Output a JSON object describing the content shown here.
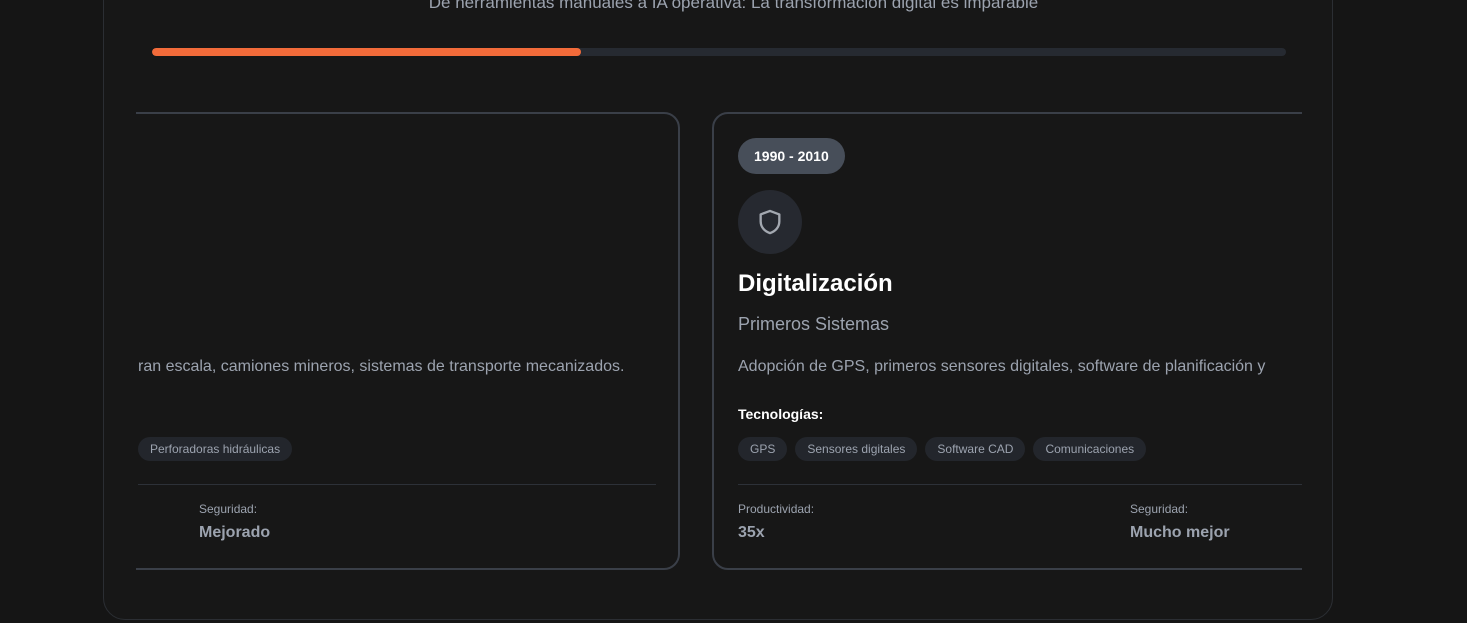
{
  "header": {
    "subtitle": "De herramientas manuales a IA operativa: La transformación digital es imparable",
    "progress_fraction": 0.378
  },
  "colors": {
    "accent": "#f26b3a",
    "background": "#151515",
    "pill": "#474e59",
    "tag": "#23262c"
  },
  "cards": [
    {
      "period": "",
      "title": "",
      "subtitle": "",
      "description": "ran escala, camiones mineros, sistemas de transporte mecanizados.",
      "tech_heading": "",
      "technologies": [
        "Perforadoras hidráulicas"
      ],
      "metrics": [
        {
          "label": "Seguridad:",
          "value": "Mejorado"
        }
      ]
    },
    {
      "period": "1990 - 2010",
      "icon": "shield-icon",
      "title": "Digitalización",
      "subtitle": "Primeros Sistemas",
      "description": "Adopción de GPS, primeros sensores digitales, software de planificación y",
      "tech_heading": "Tecnologías:",
      "technologies": [
        "GPS",
        "Sensores digitales",
        "Software CAD",
        "Comunicaciones"
      ],
      "metrics": [
        {
          "label": "Productividad:",
          "value": "35x"
        },
        {
          "label": "Seguridad:",
          "value": "Mucho mejor"
        }
      ]
    }
  ]
}
